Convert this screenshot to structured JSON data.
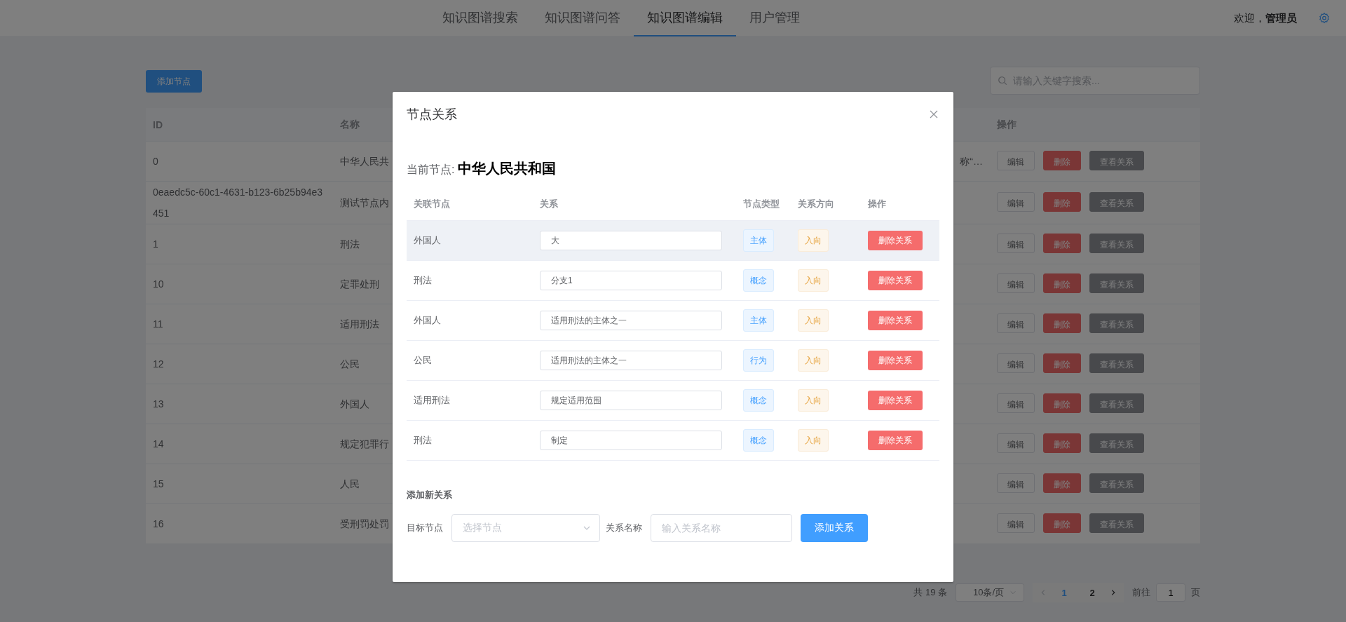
{
  "nav": {
    "tabs": [
      {
        "label": "知识图谱搜索",
        "selected": false
      },
      {
        "label": "知识图谱问答",
        "selected": false
      },
      {
        "label": "知识图谱编辑",
        "selected": true
      },
      {
        "label": "用户管理",
        "selected": false
      }
    ],
    "welcome": "欢迎，",
    "user": "管理员"
  },
  "toolbar": {
    "add_button": "添加节点",
    "search": {
      "placeholder": "请输入关键字搜索..."
    }
  },
  "table": {
    "columns": {
      "id": "ID",
      "name": "名称",
      "actions": "操作"
    },
    "rows": [
      {
        "id": "0",
        "name": "中华人民共",
        "column_3": "称“…",
        "edit": "编辑",
        "delete": "删除",
        "view": "查看关系"
      },
      {
        "id": "0eaedc5c-60c1-4631-b123-6b25b94e3451",
        "name": "测试节点内",
        "edit": "编辑",
        "delete": "删除",
        "view": "查看关系"
      },
      {
        "id": "1",
        "name": "刑法",
        "edit": "编辑",
        "delete": "删除",
        "view": "查看关系"
      },
      {
        "id": "10",
        "name": "定罪处刑",
        "edit": "编辑",
        "delete": "删除",
        "view": "查看关系"
      },
      {
        "id": "11",
        "name": "适用刑法",
        "edit": "编辑",
        "delete": "删除",
        "view": "查看关系"
      },
      {
        "id": "12",
        "name": "公民",
        "edit": "编辑",
        "delete": "删除",
        "view": "查看关系"
      },
      {
        "id": "13",
        "name": "外国人",
        "edit": "编辑",
        "delete": "删除",
        "view": "查看关系"
      },
      {
        "id": "14",
        "name": "规定犯罪行",
        "edit": "编辑",
        "delete": "删除",
        "view": "查看关系"
      },
      {
        "id": "15",
        "name": "人民",
        "edit": "编辑",
        "delete": "删除",
        "view": "查看关系"
      },
      {
        "id": "16",
        "name": "受刑罚处罚",
        "edit": "编辑",
        "delete": "删除",
        "view": "查看关系"
      }
    ]
  },
  "pagination": {
    "total": "共 19 条",
    "page_size": "10条/页",
    "pages": [
      {
        "label": "1",
        "selected": true
      },
      {
        "label": "2",
        "selected": false
      }
    ],
    "goto_label": "前往",
    "goto_value": "1",
    "goto_suffix": "页"
  },
  "dialog": {
    "title": "节点关系",
    "current_label": "当前节点:",
    "current_node": "中华人民共和国",
    "columns": [
      "关联节点",
      "关系",
      "节点类型",
      "关系方向",
      "操作"
    ],
    "relations": [
      {
        "node": "外国人",
        "relation": "大",
        "type": "主体",
        "direction": "入向",
        "delete_button": "删除关系",
        "highlighted": true
      },
      {
        "node": "刑法",
        "relation": "分支1",
        "type": "概念",
        "direction": "入向",
        "delete_button": "删除关系",
        "highlighted": false
      },
      {
        "node": "外国人",
        "relation": "适用刑法的主体之一",
        "type": "主体",
        "direction": "入向",
        "delete_button": "删除关系",
        "highlighted": false
      },
      {
        "node": "公民",
        "relation": "适用刑法的主体之一",
        "type": "行为",
        "direction": "入向",
        "delete_button": "删除关系",
        "highlighted": false
      },
      {
        "node": "适用刑法",
        "relation": "规定适用范围",
        "type": "概念",
        "direction": "入向",
        "delete_button": "删除关系",
        "highlighted": false
      },
      {
        "node": "刑法",
        "relation": "制定",
        "type": "概念",
        "direction": "入向",
        "delete_button": "删除关系",
        "highlighted": false
      }
    ],
    "add_section": {
      "heading": "添加新关系",
      "target_label": "目标节点",
      "target_placeholder": "选择节点",
      "name_label": "关系名称",
      "name_placeholder": "输入关系名称",
      "submit": "添加关系"
    }
  }
}
